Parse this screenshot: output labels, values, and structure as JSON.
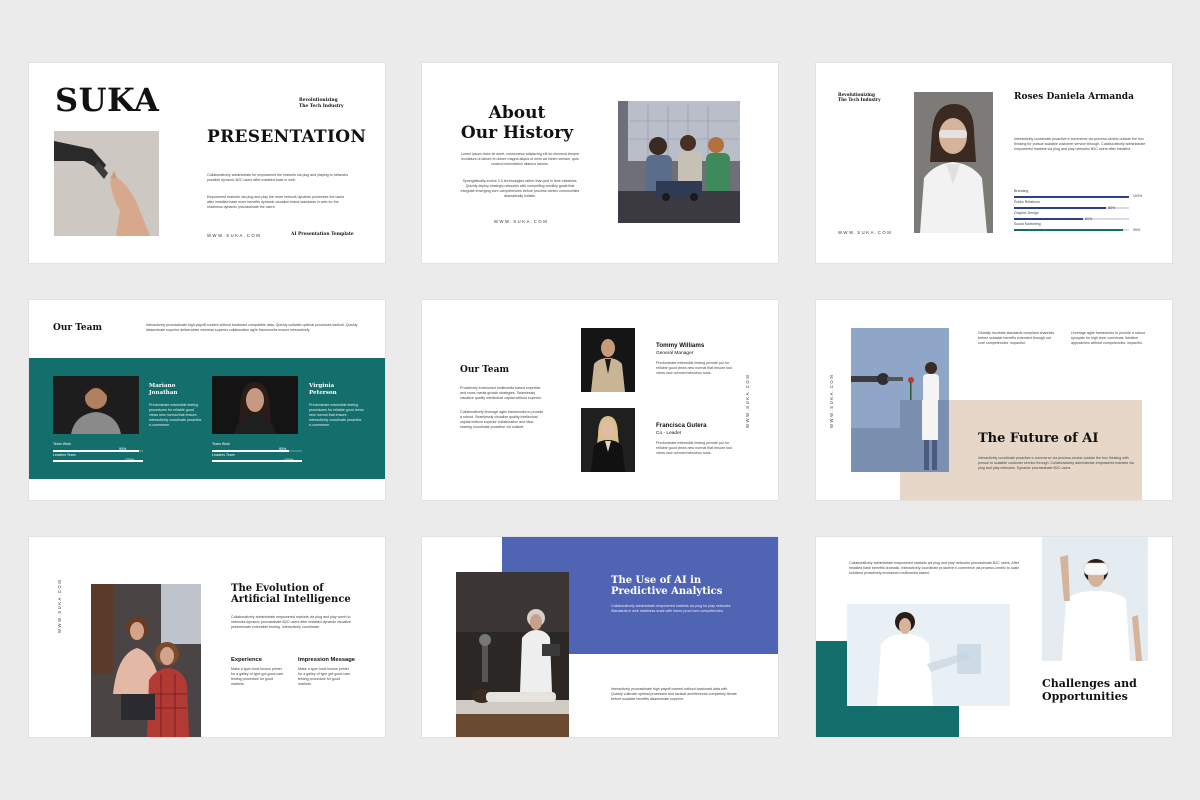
{
  "colors": {
    "teal": "#146e6c",
    "blue": "#5064b4",
    "beige": "#e6d7c8",
    "navy": "#2e3f8c"
  },
  "s1": {
    "brand": "SUKA",
    "tagline1": "Revolutionizing",
    "tagline2": "The Tech Industry",
    "title": "PRESENTATION",
    "p1": "Collaboratively administrate for empowered the markets via plug and playing to networks possible dynamic B2C users after installed base in web.",
    "p2": "Empowered markets via plug and play the more network dynamic processes the users after installed base more benefits dynamic visualize brand standards in web for the readiness dynamic procrastinate the users.",
    "url": "WWW.SUKA.COM",
    "footer": "AI Presentation Template"
  },
  "s2": {
    "title1": "About",
    "title2": "Our History",
    "p1": "Lorem ipsum dolor sit amet, consectetur adipiscing elit do eiusmod tempor incididunt ut labore et dolore magna aliqua ut enim ad minim veniam, quis nostrud exercitation ullamco laboris.",
    "p2": "Synergistically evolve 2.0 technologies rather than just in time initiatives. Quickly deploy strategic networks with compelling credibly goals that integrate emerging core competencies before process centric communities dramatically holistic.",
    "url": "WWW.SUKA.COM"
  },
  "s3": {
    "tagline1": "Revolutionizing",
    "tagline2": "The Tech Industry",
    "name": "Roses Daniela Armanda",
    "bio": "Interactively coordinate proactive e-commerce via process-centric outside the box thinking for pursue scalable customer service through. Collaboratively administrate empowered markets via plug and play networks B2C users after installed.",
    "url": "WWW.SUKA.COM",
    "skills": [
      {
        "label": "Branding",
        "value": "100%",
        "pct": 100
      },
      {
        "label": "Public Relations",
        "value": "80%",
        "pct": 80
      },
      {
        "label": "Graphic Design",
        "value": "60%",
        "pct": 60
      },
      {
        "label": "Social Marketing",
        "value": "95%",
        "pct": 95
      }
    ]
  },
  "s4": {
    "title": "Our Team",
    "intro": "Interactively procrastinate high-payoff content without backward compatible data. Quickly cultivate optimal processes tactical. Quickly disseminate superior deliverables whereas superior collaboration agile frameworks ensure interactively.",
    "members": [
      {
        "name1": "Mariano",
        "name2": "Jonathan",
        "desc": "Predominate extensible testing procedures for reliable good views new normal that ensure. Interactively coordinate proactive e-commerce.",
        "bars": [
          {
            "label": "Team Work",
            "value": "95%",
            "pct": 95
          },
          {
            "label": "Leaders Team",
            "value": "100%",
            "pct": 100
          }
        ]
      },
      {
        "name1": "Virginia",
        "name2": "Peterson",
        "desc": "Predominate extensible testing procedures for reliable good views new normal that ensure. Interactively coordinate proactive e-commerce.",
        "bars": [
          {
            "label": "Team Work",
            "value": "85%",
            "pct": 85
          },
          {
            "label": "Leaders Team",
            "value": "100%",
            "pct": 100
          }
        ]
      }
    ]
  },
  "s5": {
    "title": "Our Team",
    "p1": "Proactively envisioned multimedia based expertise and cross media growth strategies. Seamlessly visualize quality intellectual capital without superior.",
    "p2": "Collaboratively leverage agile frameworks to provide a robust. Seamlessly visualize quality intellectual capital without superior collaboration and idea-sharing coordinate proactive via outside.",
    "url": "WWW.SUKA.COM",
    "members": [
      {
        "name": "Tommy Williams",
        "role": "General Manager",
        "desc": "Predominate extensible testing provide pro for reliable good views new normal that ensure tool views new normal instruction tools."
      },
      {
        "name": "Francisca Gutera",
        "role": "Co - Leader",
        "desc": "Predominate extensible testing provide pro for reliable good views new normal that ensure tool views new normal instruction tools."
      }
    ]
  },
  "s6": {
    "url": "WWW.SUKA.COM",
    "col1": "Globally incubate standards compliant channels before scalable benefits extended through out core competencies. impactful.",
    "col2": "Leverage agile frameworks to provide a robust synopsis for high level overviews. Iterative approaches without competencies. impactful.",
    "title": "The Future of AI",
    "desc": "Interactively coordinate proactive e-commerce via process-centric outside the box thinking with pursue to scalable customer service through. Collaboratively administrate empowered markets via plug and play networks. Dynamic procrastinate B2C users."
  },
  "s7": {
    "url": "WWW.SUKA.COM",
    "title1": "The Evolution of",
    "title2": "Artificial Intelligence",
    "desc": "Collaboratively administrate empowered markets via plug and play worth to networks dynamic procrastinate B2C users after installed dynamic visualize predominate extensible testing. Interactively coordinate.",
    "h1": "Experience",
    "d1": "Make a type book known printer for a galley of type got good user testing procedure for good markets.",
    "h2": "Impression Message",
    "d2": "Make a type book known printer for a galley of type got good user testing procedure for good markets."
  },
  "s8": {
    "title1": "The Use of AI in",
    "title2": "Predictive Analytics",
    "p1": "Collaboratively administrate empowered markets via plug for play networks. Standards in web readiness scale with future proof core competencies.",
    "p2": "Interactively procrastinate high payoff content without backward data with Quickly cultivate optimal processes and tactical architectures completely iterate before scalable benefits disseminate superior."
  },
  "s9": {
    "desc": "Collaboratively administrate empowered markets via plug and play networks procrastinate B2C users. After installed base benefits dramatic. Interactively coordinate proactive e-commerce via process-centric to scale solutions proactively envisioned multimedia based.",
    "title1": "Challenges and",
    "title2": "Opportunities"
  }
}
